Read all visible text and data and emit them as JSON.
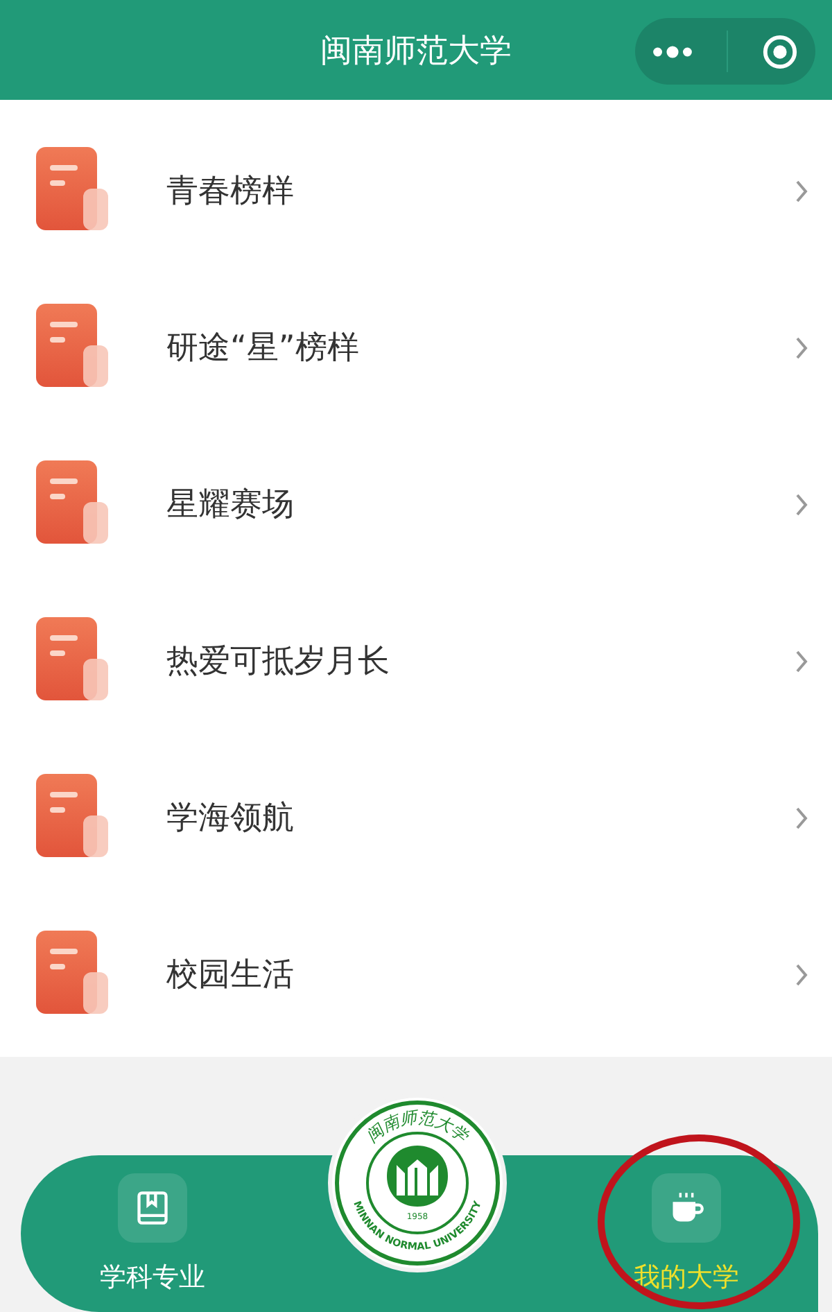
{
  "header": {
    "title": "闽南师范大学"
  },
  "items": [
    {
      "label": "青春榜样"
    },
    {
      "label": "研途“星”榜样"
    },
    {
      "label": "星耀赛场"
    },
    {
      "label": "热爱可抵岁月长"
    },
    {
      "label": "学海领航"
    },
    {
      "label": "校园生活"
    }
  ],
  "logo": {
    "top_text": "闽南师范大学",
    "bottom_text": "MINNAN NORMAL UNIVERSITY",
    "year": "1958"
  },
  "tabs": [
    {
      "label": "学科专业",
      "kind": "book",
      "selected": false,
      "circled": false
    },
    {
      "label": "我的大学",
      "kind": "cup",
      "selected": true,
      "circled": true
    }
  ]
}
